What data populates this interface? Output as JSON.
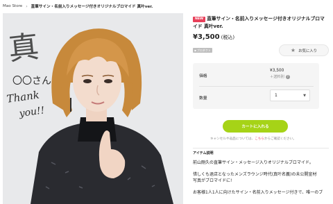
{
  "breadcrumb": {
    "store": "Mao Store",
    "separator": "›",
    "current": "直筆サイン・名前入りメッセージ付きオリジナルブロマイド 真叶ver."
  },
  "product": {
    "new_badge": "NEW",
    "title": "直筆サイン・名前入りメッセージ付きオリジナルブロマイド 真叶ver.",
    "price": "¥3,500",
    "tax_note": "(税込)",
    "pro_badge": "プロダクト",
    "favorite_label": "お気に入り"
  },
  "purchase": {
    "price_label": "価格",
    "price_value": "¥3,500",
    "shipping_note": "＋送料別",
    "quantity_label": "数量",
    "quantity_value": "1",
    "cart_button": "カートに入れる",
    "cancel_note_prefix": "キャンセルや返品については、",
    "cancel_link": "こちら",
    "cancel_note_suffix": "からご確認ください。"
  },
  "description": {
    "heading": "アイテム説明",
    "paragraphs": [
      "前山剛久の直筆サイン・メッセージ入りオリジナルブロマイド。",
      "惜しくも退店となったメンズラウンジ時代(真叶名義)の未公開宣材",
      "写真がブロマイドに!",
      "お客様1人1人に向けたサイン・名前入りメッセージ付きで、唯一のブ"
    ]
  },
  "signature": {
    "name_text": "真",
    "greeting": "〇〇さん",
    "thanks": "Thank",
    "you": "you!!"
  },
  "colors": {
    "accent_green": "#a6d317",
    "new_badge": "#e8405a",
    "link_pink": "#e84f6a"
  }
}
